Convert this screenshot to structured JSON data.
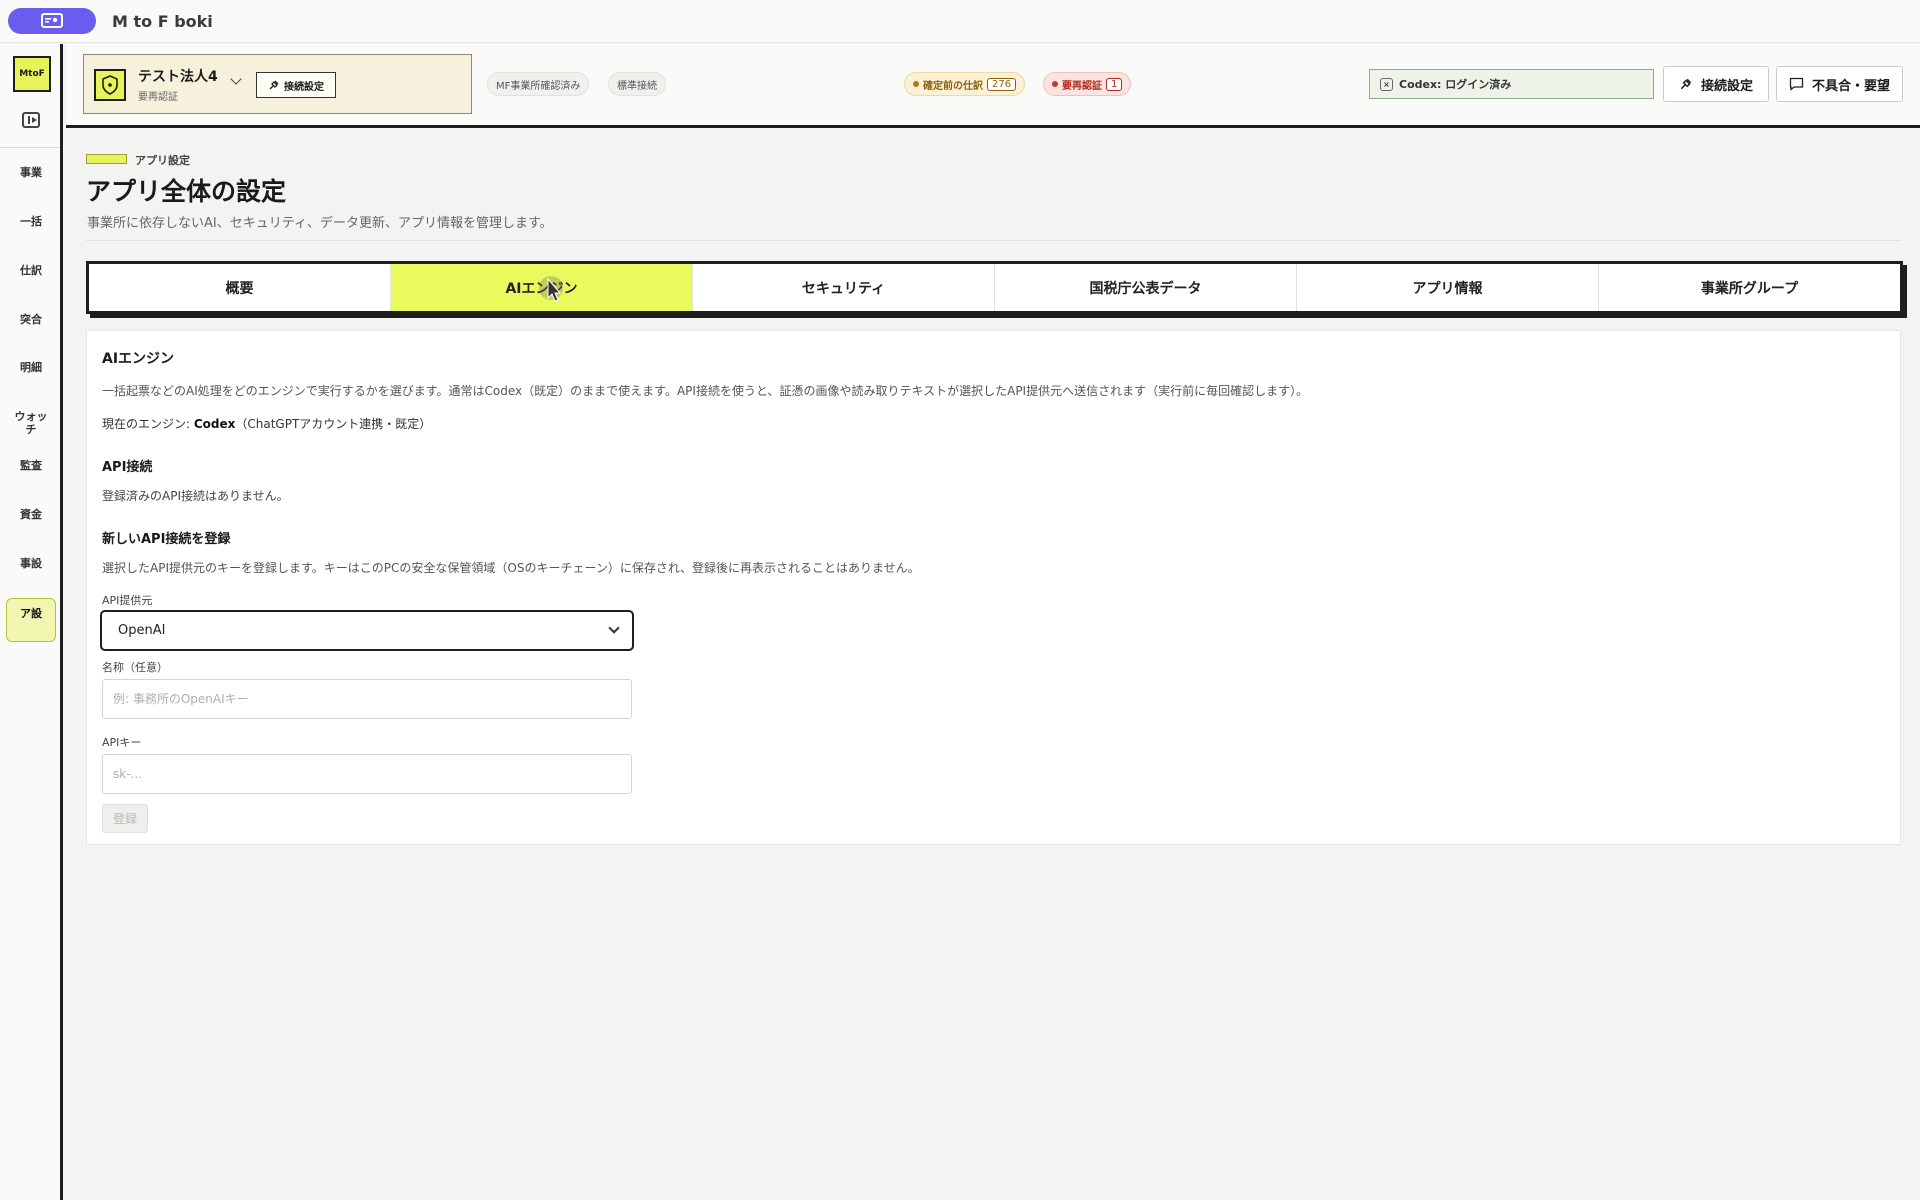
{
  "window": {
    "title": "M to F boki"
  },
  "sidebar": {
    "logo": "MtoF",
    "items": [
      {
        "label": "事業"
      },
      {
        "label": "一括"
      },
      {
        "label": "仕訳"
      },
      {
        "label": "突合"
      },
      {
        "label": "明細"
      },
      {
        "label": "ウォッチ"
      },
      {
        "label": "監査"
      },
      {
        "label": "資金"
      },
      {
        "label": "事設"
      },
      {
        "label": "ア設"
      }
    ]
  },
  "topbar": {
    "office_name": "テスト法人4",
    "office_sub": "要再認証",
    "connect_label": "接続設定",
    "chips": [
      "MF事業所確認済み",
      "標準接続"
    ],
    "pending_label": "確定前の仕訳",
    "pending_count": "276",
    "reauth_label": "要再認証",
    "reauth_count": "1",
    "codex_status": "Codex: ログイン済み",
    "connect_settings": "接続設定",
    "feedback": "不具合・要望",
    "colors": {
      "accent": "#e7f35a",
      "pending": "#b07a10",
      "alert": "#c0392b"
    }
  },
  "page": {
    "breadcrumb": "アプリ設定",
    "title": "アプリ全体の設定",
    "description": "事業所に依存しないAI、セキュリティ、データ更新、アプリ情報を管理します。"
  },
  "tabs": [
    {
      "label": "概要"
    },
    {
      "label": "AIエンジン"
    },
    {
      "label": "セキュリティ"
    },
    {
      "label": "国税庁公表データ"
    },
    {
      "label": "アプリ情報"
    },
    {
      "label": "事業所グループ"
    }
  ],
  "active_tab": "AIエンジン",
  "ai_engine": {
    "heading": "AIエンジン",
    "description": "一括起票などのAI処理をどのエンジンで実行するかを選びます。通常はCodex（既定）のままで使えます。API接続を使うと、証憑の画像や読み取りテキストが選択したAPI提供元へ送信されます（実行前に毎回確認します）。",
    "current_prefix": "現在のエンジン: ",
    "current_engine": "Codex",
    "current_suffix": "（ChatGPTアカウント連携・既定）",
    "api_heading": "API接続",
    "api_empty": "登録済みのAPI接続はありません。",
    "new_heading": "新しいAPI接続を登録",
    "new_description": "選択したAPI提供元のキーを登録します。キーはこのPCの安全な保管領域（OSのキーチェーン）に保存され、登録後に再表示されることはありません。",
    "provider_label": "API提供元",
    "provider_value": "OpenAI",
    "name_label": "名称（任意）",
    "name_placeholder": "例: 事務所のOpenAIキー",
    "key_label": "APIキー",
    "key_placeholder": "sk-...",
    "submit_label": "登録"
  }
}
